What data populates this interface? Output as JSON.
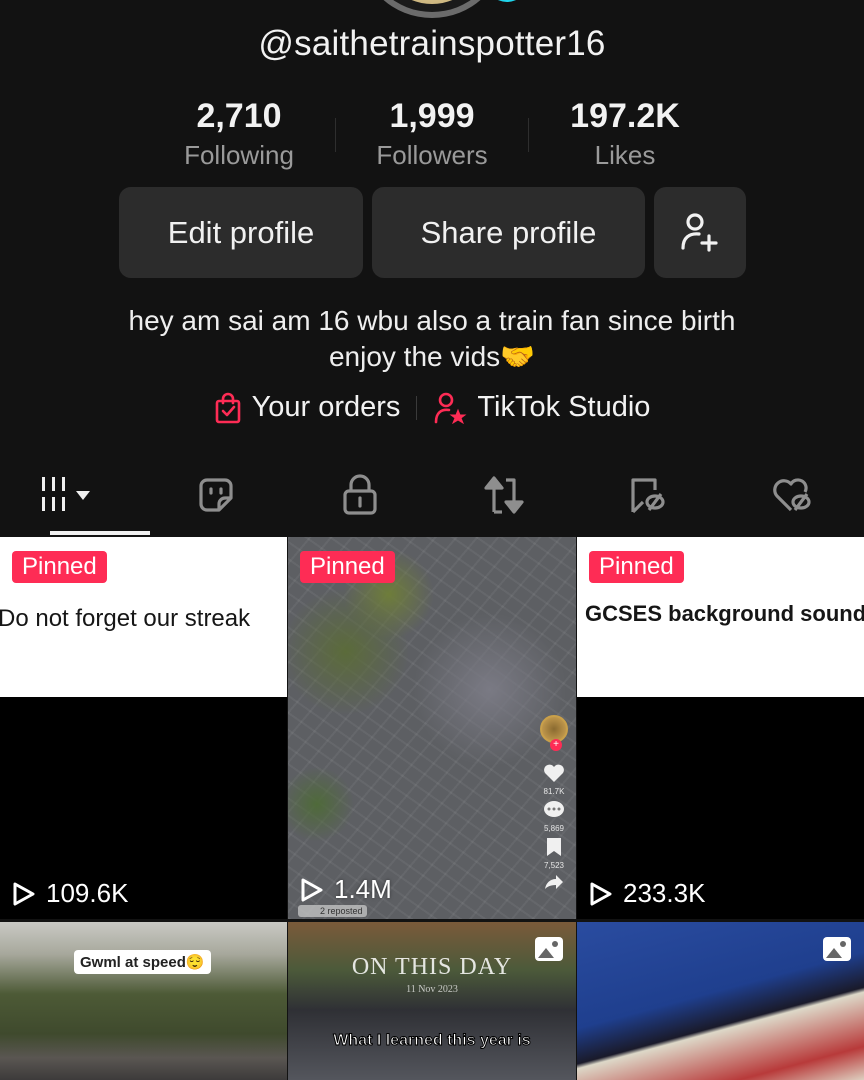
{
  "profile": {
    "username": "@saithetrainspotter16",
    "stats": [
      {
        "value": "2,710",
        "label": "Following"
      },
      {
        "value": "1,999",
        "label": "Followers"
      },
      {
        "value": "197.2K",
        "label": "Likes"
      }
    ],
    "buttons": {
      "edit": "Edit profile",
      "share": "Share profile",
      "add_friend_icon": "person-plus-icon"
    },
    "bio_line1": "hey am sai am 16 wbu also a train fan since birth",
    "bio_line2": "enjoy the vids🤝",
    "links": [
      {
        "label": "Your orders",
        "icon": "shopping-bag-icon"
      },
      {
        "label": "TikTok Studio",
        "icon": "creator-star-icon"
      }
    ],
    "accent_color": "#fe2c55",
    "verified_badge_color": "#20d5ec"
  },
  "tabs": [
    {
      "name": "videos",
      "icon": "grid-dropdown-icon",
      "active": true
    },
    {
      "name": "stickers",
      "icon": "sticker-icon",
      "active": false
    },
    {
      "name": "private",
      "icon": "lock-icon",
      "active": false
    },
    {
      "name": "reposts",
      "icon": "repost-icon",
      "active": false
    },
    {
      "name": "favorites",
      "icon": "bookmark-hidden-icon",
      "active": false
    },
    {
      "name": "liked",
      "icon": "heart-hidden-icon",
      "active": false
    }
  ],
  "videos": [
    {
      "pinned_label": "Pinned",
      "caption": "Do not forget our streak",
      "views": "109.6K"
    },
    {
      "pinned_label": "Pinned",
      "views": "1.4M",
      "overlay": {
        "likes": "81.7K",
        "comments": "5,869",
        "saves": "7,523",
        "reposted": "2 reposted"
      }
    },
    {
      "pinned_label": "Pinned",
      "caption": "GCSES background sounds",
      "views": "233.3K"
    },
    {
      "caption": "Gwml at speed😌"
    },
    {
      "title": "ON THIS DAY",
      "date": "11 Nov 2023",
      "caption": "What I learned this year is",
      "type": "photo"
    },
    {
      "type": "photo"
    }
  ]
}
